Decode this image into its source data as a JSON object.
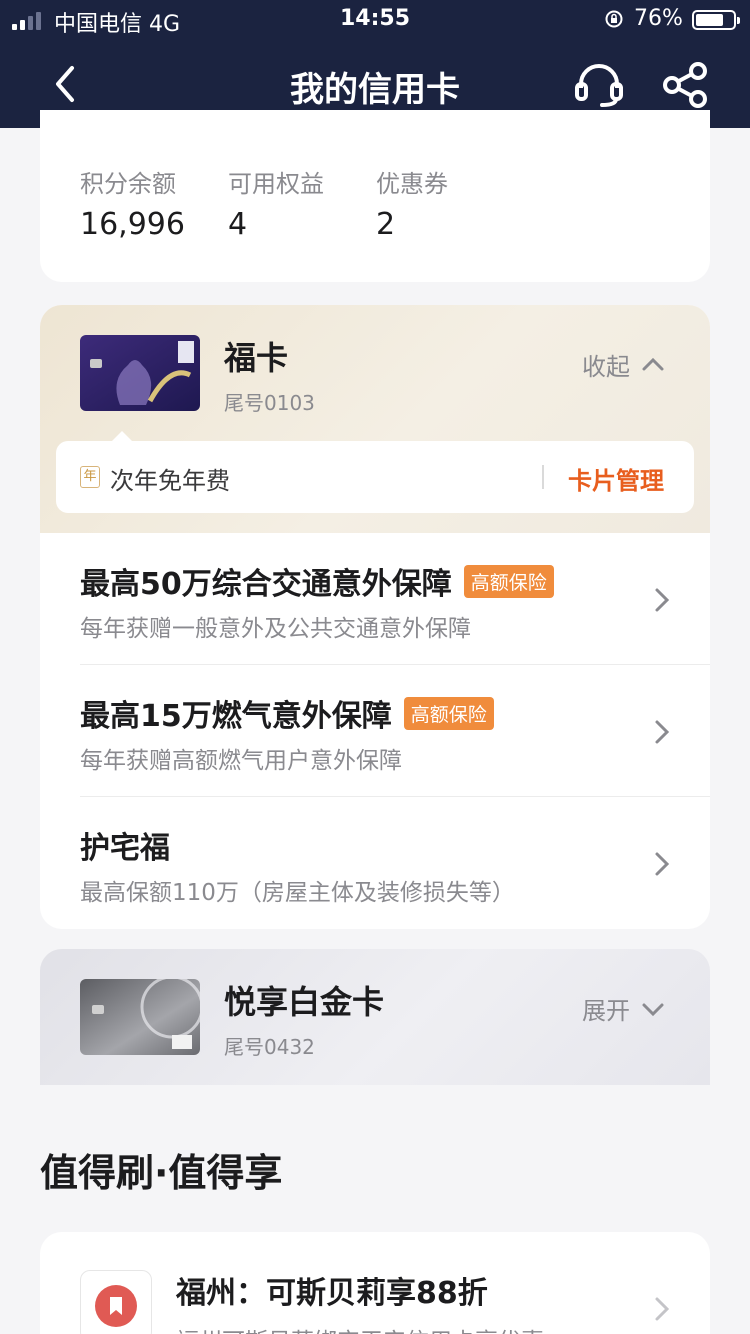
{
  "status_bar": {
    "carrier": "中国电信  4G",
    "time": "14:55",
    "battery": "76%",
    "battery_level": 0.76
  },
  "nav": {
    "title": "我的信用卡"
  },
  "summary": {
    "items": [
      {
        "label": "积分余额",
        "value": "16,996"
      },
      {
        "label": "可用权益",
        "value": "4"
      },
      {
        "label": "优惠券",
        "value": "2"
      }
    ]
  },
  "fuka": {
    "name": "福卡",
    "tail": "尾号0103",
    "toggle": "收起",
    "fee_badge": "年",
    "fee_text": "次年免年费",
    "manage": "卡片管理",
    "benefits": [
      {
        "title": "最高50万综合交通意外保障",
        "tag": "高额保险",
        "sub": "每年获赠一般意外及公共交通意外保障"
      },
      {
        "title": "最高15万燃气意外保障",
        "tag": "高额保险",
        "sub": "每年获赠高额燃气用户意外保障"
      },
      {
        "title": "护宅福",
        "tag": "",
        "sub": "最高保额110万（房屋主体及装修损失等）"
      }
    ]
  },
  "baijin": {
    "name": "悦享白金卡",
    "tail": "尾号0432",
    "toggle": "展开"
  },
  "section": {
    "title": "值得刷·值得享"
  },
  "promo": {
    "title": "福州：可斯贝莉享88折",
    "sub": "福州可斯贝莉绑定平安信用卡享优惠"
  },
  "colors": {
    "nav_bg": "#1b2340",
    "accent": "#e85e1e",
    "tag": "#f08c3c"
  },
  "icons": [
    "back-icon",
    "headset-icon",
    "share-icon",
    "chevron-up-icon",
    "chevron-down-icon",
    "chevron-right-icon",
    "bookmark-icon"
  ]
}
